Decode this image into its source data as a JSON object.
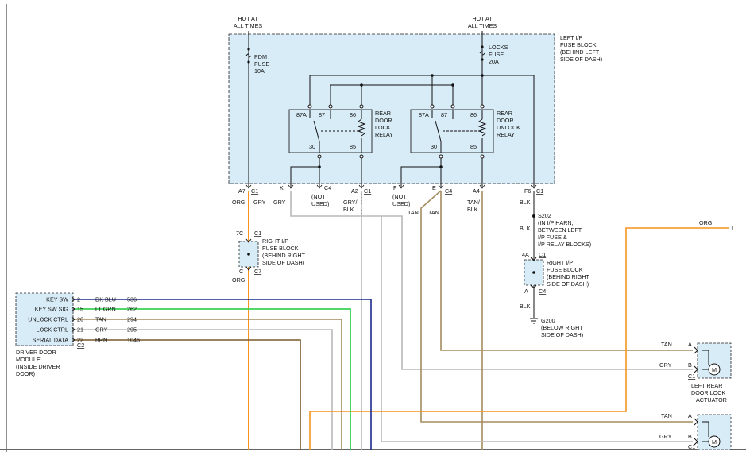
{
  "sources": {
    "left_hot": [
      "HOT AT",
      "ALL TIMES"
    ],
    "right_hot": [
      "HOT AT",
      "ALL TIMES"
    ]
  },
  "fuses": {
    "pdm": [
      "PDM",
      "FUSE",
      "10A"
    ],
    "locks": [
      "LOCKS",
      "FUSE",
      "20A"
    ]
  },
  "fuse_block_left": [
    "LEFT I/P",
    "FUSE BLOCK",
    "(BEHIND LEFT",
    "SIDE OF DASH)"
  ],
  "relays": {
    "lock": [
      "REAR",
      "DOOR",
      "LOCK",
      "RELAY"
    ],
    "unlock": [
      "REAR",
      "DOOR",
      "UNLOCK",
      "RELAY"
    ],
    "pins": {
      "p87a": "87A",
      "p87": "87",
      "p86": "86",
      "p30": "30",
      "p85": "85"
    }
  },
  "connectors": {
    "a7": "A7",
    "c1": "C1",
    "k": "K",
    "c4": "C4",
    "a2": "A2",
    "f": "F",
    "e": "E",
    "a4": "A4",
    "f6": "F6",
    "not_used": [
      "(NOT",
      "USED)"
    ],
    "c7": "C7",
    "p7c": "7C",
    "pc": "C",
    "p4a": "4A",
    "pa": "A",
    "c2": "C2",
    "act_a": "A",
    "act_b": "B"
  },
  "wire_colors": {
    "org": "ORG",
    "gry": "GRY",
    "gry_blk": [
      "GRY/",
      "BLK"
    ],
    "tan": "TAN",
    "tan_blk": [
      "TAN/",
      "BLK"
    ],
    "blk": "BLK",
    "dk_blu": "DK BLU",
    "lt_grn": "LT GRN",
    "brn": "BRN"
  },
  "right_fuse_block": [
    "RIGHT I/P",
    "FUSE BLOCK",
    "(BEHIND RIGHT",
    "SIDE OF DASH)"
  ],
  "splice": {
    "id": "S202",
    "desc": [
      "(IN I/P HARN,",
      "BETWEEN LEFT",
      "I/P FUSE &",
      "I/P RELAY BLOCKS)"
    ]
  },
  "ground": {
    "id": "G200",
    "desc": [
      "(BELOW RIGHT",
      "SIDE OF DASH)"
    ]
  },
  "offpage": {
    "label": "ORG",
    "ref": "1"
  },
  "module": {
    "pins": [
      {
        "label": "KEY SW",
        "pin": "2",
        "color": "DK BLU",
        "circuit": "536"
      },
      {
        "label": "KEY SW SIG",
        "pin": "15",
        "color": "LT GRN",
        "circuit": "262"
      },
      {
        "label": "UNLOCK CTRL",
        "pin": "20",
        "color": "TAN",
        "circuit": "294"
      },
      {
        "label": "LOCK CTRL",
        "pin": "21",
        "color": "GRY",
        "circuit": "295"
      },
      {
        "label": "SERIAL DATA",
        "pin": "22",
        "color": "BRN",
        "circuit": "1046"
      }
    ],
    "connector": "C2",
    "name": [
      "DRIVER DOOR",
      "MODULE",
      "(INSIDE DRIVER",
      "DOOR)"
    ]
  },
  "actuator": {
    "name": [
      "LEFT REAR",
      "DOOR LOCK",
      "ACTUATOR"
    ],
    "connector": "C1",
    "motor": "M"
  },
  "colors": {
    "org": "#f7941d",
    "gry": "#b8b8b8",
    "tan": "#a38c5e",
    "brn": "#7a5a2a",
    "grn": "#39d353",
    "blu": "#1a2a8a",
    "blk": "#111111",
    "fill": "#d8ecf7"
  }
}
